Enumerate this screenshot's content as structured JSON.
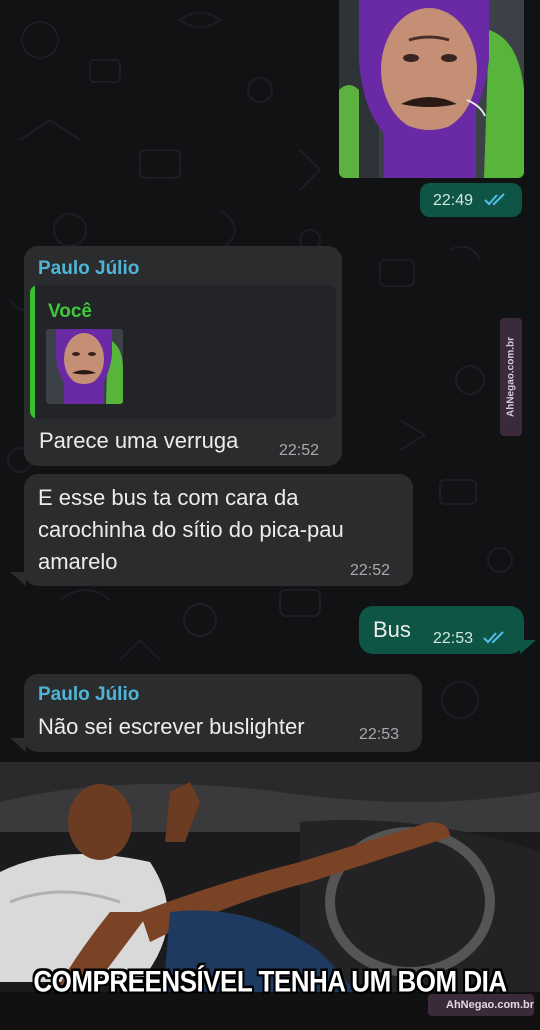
{
  "chat": {
    "messages": [
      {
        "time": "22:49"
      },
      {
        "sender": "Paulo Júlio",
        "quote_sender": "Você",
        "text": "Parece uma verruga",
        "time": "22:52"
      },
      {
        "lines": [
          "E esse bus ta com cara da",
          "carochinha do sítio do pica-pau",
          "amarelo"
        ],
        "time": "22:52"
      },
      {
        "text": "Bus",
        "time": "22:53"
      },
      {
        "sender": "Paulo Júlio",
        "text": "Não sei escrever buslighter",
        "time": "22:53"
      }
    ]
  },
  "watermark": {
    "side": "AhNegao.com.br",
    "bottom": "AhNegao.com.br"
  },
  "meme": {
    "caption": "COMPREENSÍVEL TENHA UM BOM DIA"
  },
  "colors": {
    "chat_background": "#111214",
    "incoming_bubble": "#2b2c2e",
    "outgoing_bubble": "#0f5545",
    "sender_name": "#4fb5d8",
    "quote_name": "#3ec93a",
    "read_ticks": "#53bdeb"
  },
  "icons": {
    "read_receipt": "double-check-icon"
  }
}
